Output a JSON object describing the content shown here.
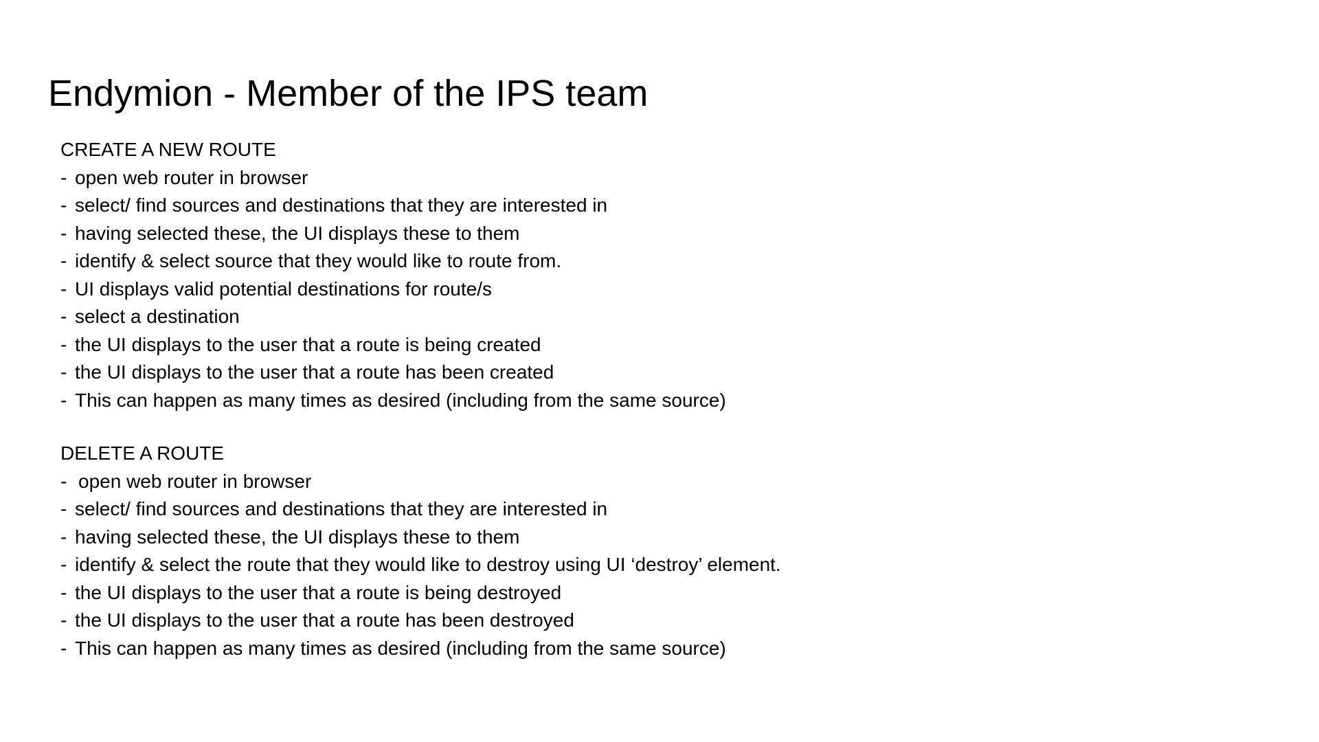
{
  "title": "Endymion - Member of the IPS team",
  "sections": [
    {
      "heading": "CREATE A NEW ROUTE",
      "bullet": "-",
      "steps": [
        "open web router in browser",
        "select/ find sources and destinations that they are interested in",
        "having selected these, the UI displays these to them",
        "identify & select source that they would like to route from.",
        "UI displays valid potential destinations for route/s",
        "select a destination",
        "the UI displays to the user that a route is being created",
        "the UI displays to the user that a route has been created",
        "This can happen as many times as desired (including from the same source)"
      ]
    },
    {
      "heading": "DELETE A ROUTE",
      "bullet": "-",
      "steps": [
        "open web router in browser",
        "select/ find sources and destinations that they are interested in",
        "having selected these, the UI displays these to them",
        "identify & select the route that they would like to destroy using UI ‘destroy’ element.",
        "the UI displays to the user that a route is being destroyed",
        "the UI displays to the user that a route has been destroyed",
        "This can happen as many times as desired (including from the same source)"
      ]
    }
  ]
}
